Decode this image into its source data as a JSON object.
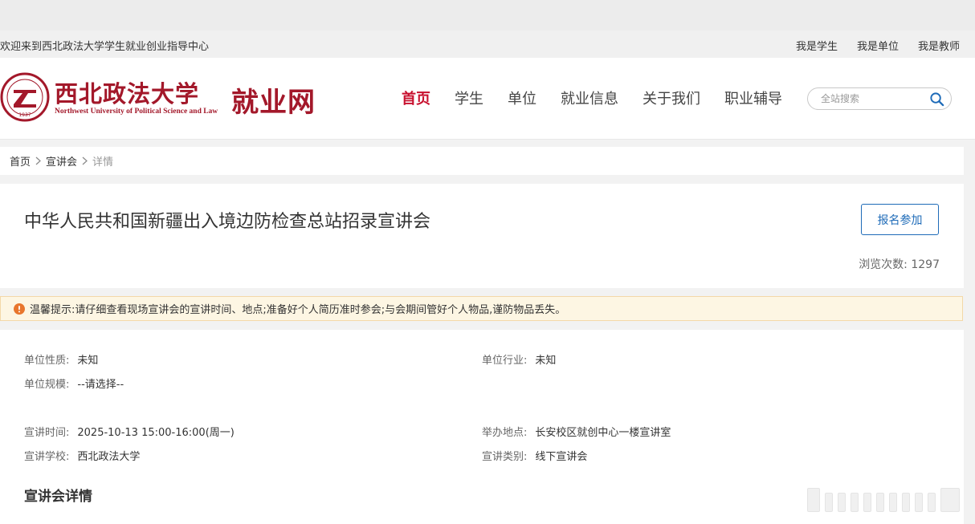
{
  "topbar": {
    "welcome": "欢迎来到西北政法大学学生就业创业指导中心",
    "links": [
      "我是学生",
      "我是单位",
      "我是教师"
    ]
  },
  "header": {
    "logo_cn": "西北政法大学",
    "logo_en": "Northwest University of Political Science and Law",
    "site_name": "就业网",
    "seal_text": "1937"
  },
  "nav": {
    "items": [
      "首页",
      "学生",
      "单位",
      "就业信息",
      "关于我们",
      "职业辅导"
    ],
    "active_index": 0
  },
  "search": {
    "placeholder": "全站搜索",
    "icon": "search-icon"
  },
  "breadcrumb": {
    "home": "首页",
    "section": "宣讲会",
    "current": "详情"
  },
  "event": {
    "title": "中华人民共和国新疆出入境边防检查总站招录宣讲会",
    "signup_label": "报名参加",
    "views_label": "浏览次数:",
    "views": "1297"
  },
  "notice": {
    "icon": "warning-icon",
    "text": "温馨提示:请仔细查看现场宣讲会的宣讲时间、地点;准备好个人简历准时参会;与会期间管好个人物品,谨防物品丢失。"
  },
  "details": {
    "unit_nature": {
      "label": "单位性质:",
      "value": "未知"
    },
    "unit_industry": {
      "label": "单位行业:",
      "value": "未知"
    },
    "unit_scale": {
      "label": "单位规模:",
      "value": "--请选择--"
    },
    "time": {
      "label": "宣讲时间:",
      "value": "2025-10-13 15:00-16:00(周一)"
    },
    "location": {
      "label": "举办地点:",
      "value": "长安校区就创中心一楼宣讲室"
    },
    "school": {
      "label": "宣讲学校:",
      "value": "西北政法大学"
    },
    "category": {
      "label": "宣讲类别:",
      "value": "线下宣讲会"
    }
  },
  "section": {
    "title": "宣讲会详情"
  },
  "colors": {
    "brand": "#a3182a",
    "nav_active": "#c8102e",
    "button": "#1e6bb8",
    "warning": "#e8762d",
    "notice_bg": "#fdf6e3"
  }
}
